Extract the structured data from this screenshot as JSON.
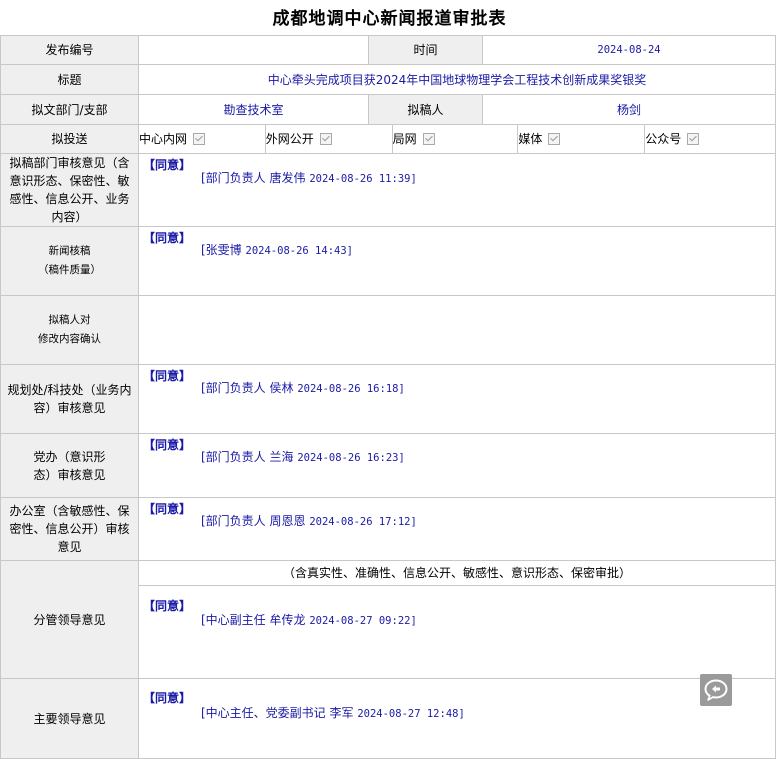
{
  "title": "成都地调中心新闻报道审批表",
  "publish_no": {
    "label": "发布编号",
    "value": ""
  },
  "time": {
    "label": "时间",
    "value": "2024-08-24"
  },
  "subject": {
    "label": "标题",
    "value": "中心牵头完成项目获2024年中国地球物理学会工程技术创新成果奖银奖"
  },
  "dept": {
    "label": "拟文部门/支部",
    "value": "勘查技术室"
  },
  "author": {
    "label": "拟稿人",
    "value": "杨剑"
  },
  "send": {
    "label": "拟投送",
    "options": [
      {
        "label": "中心内网",
        "checked": true
      },
      {
        "label": "外网公开",
        "checked": true
      },
      {
        "label": "局网",
        "checked": true
      },
      {
        "label": "媒体",
        "checked": true
      },
      {
        "label": "公众号",
        "checked": true
      }
    ]
  },
  "agree_tag": "【同意】",
  "reviews": [
    {
      "label": "拟稿部门审核意见（含意识形态、保密性、敏感性、信息公开、业务内容）",
      "sign": "[部门负责人  唐发伟",
      "time": "2024-08-26 11:39]"
    },
    {
      "label_lines": [
        "新闻核稿",
        "（稿件质量）"
      ],
      "sign": "[张雯博",
      "time": "2024-08-26 14:43]"
    },
    {
      "label_lines": [
        "拟稿人对",
        "修改内容确认"
      ]
    },
    {
      "label": "规划处/科技处（业务内容）审核意见",
      "sign": "[部门负责人  侯林",
      "time": "2024-08-26 16:18]"
    },
    {
      "label": "党办（意识形态）审核意见",
      "sign": "[部门负责人  兰海",
      "time": "2024-08-26 16:23]"
    },
    {
      "label": "办公室（含敏感性、保密性、信息公开）审核意见",
      "sign": "[部门负责人  周恩恩",
      "time": "2024-08-26 17:12]"
    },
    {
      "label": "分管领导意见",
      "note": "（含真实性、准确性、信息公开、敏感性、意识形态、保密审批）",
      "sign": "[中心副主任  牟传龙",
      "time": "2024-08-27 09:22]"
    },
    {
      "label": "主要领导意见",
      "sign": "[中心主任、党委副书记  李军",
      "time": "2024-08-27 12:48]"
    }
  ],
  "icons": {
    "chat": "chat-bubble-icon"
  }
}
